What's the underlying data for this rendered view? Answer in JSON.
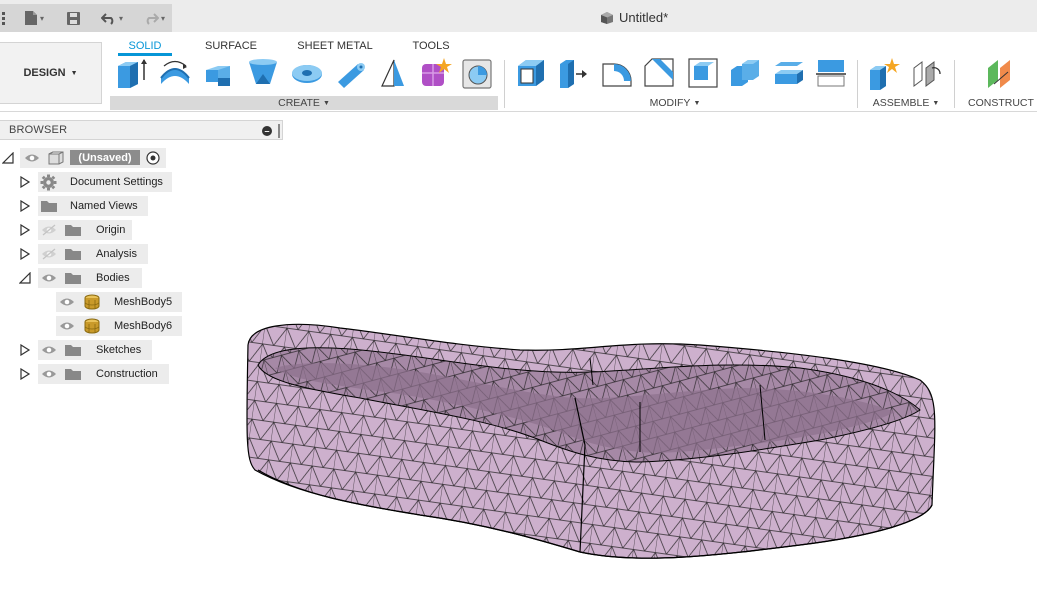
{
  "window": {
    "title": "Untitled*"
  },
  "ribbon": {
    "workspace": "DESIGN",
    "tabs": [
      {
        "label": "SOLID",
        "active": true
      },
      {
        "label": "SURFACE",
        "active": false
      },
      {
        "label": "SHEET METAL",
        "active": false
      },
      {
        "label": "TOOLS",
        "active": false
      }
    ],
    "groups": {
      "create": "CREATE",
      "modify": "MODIFY",
      "assemble": "ASSEMBLE",
      "construct": "CONSTRUCT"
    }
  },
  "browser": {
    "title": "BROWSER",
    "root": "(Unsaved)",
    "items": [
      {
        "label": "Document Settings",
        "icon": "gear-icon"
      },
      {
        "label": "Named Views",
        "icon": "folder-icon"
      },
      {
        "label": "Origin",
        "icon": "folder-icon",
        "visibility": "hidden"
      },
      {
        "label": "Analysis",
        "icon": "folder-icon",
        "visibility": "hidden"
      },
      {
        "label": "Bodies",
        "icon": "folder-icon",
        "visibility": "visible",
        "expanded": true
      },
      {
        "label": "MeshBody5",
        "icon": "mesh-body-icon",
        "visibility": "visible"
      },
      {
        "label": "MeshBody6",
        "icon": "mesh-body-icon",
        "visibility": "visible"
      },
      {
        "label": "Sketches",
        "icon": "folder-icon",
        "visibility": "visible"
      },
      {
        "label": "Construction",
        "icon": "folder-icon",
        "visibility": "visible"
      }
    ]
  },
  "colors": {
    "accent": "#0696d7",
    "tool_blue": "#3b9ae1",
    "mesh_fill": "#cdb0cd",
    "mesh_dark": "#8d708d"
  }
}
